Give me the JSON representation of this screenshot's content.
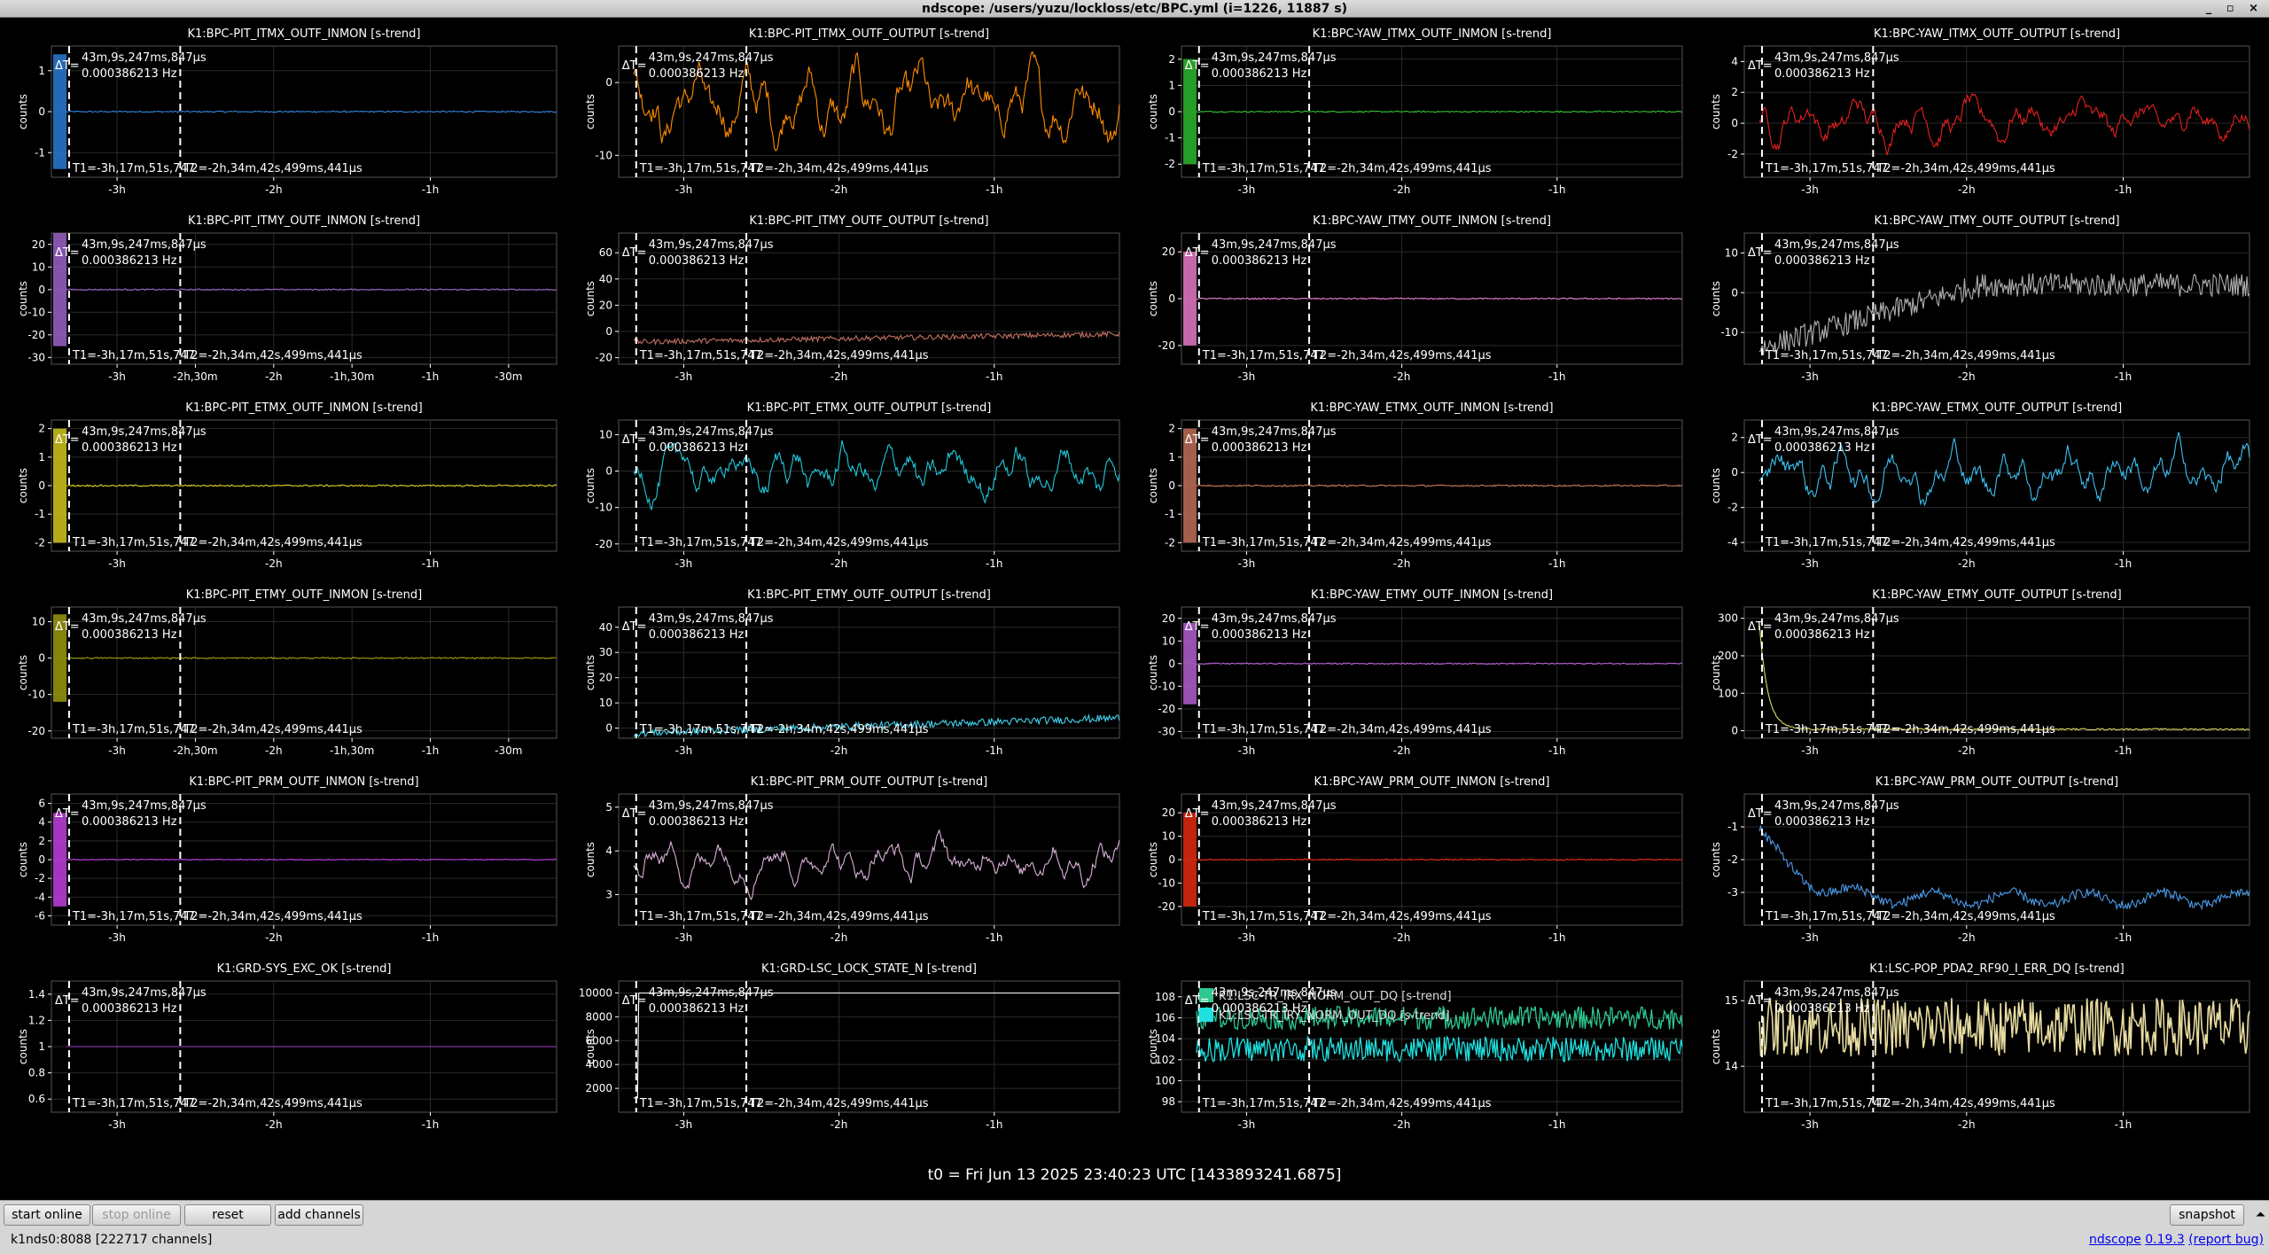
{
  "window": {
    "title": "ndscope: /users/yuzu/lockloss/etc/BPC.yml (i=1226, 11887 s)",
    "controls": "_ ▫ ×"
  },
  "cursor": {
    "dt_label": "ΔT=",
    "dt": "43m,9s,247ms,847μs",
    "freq": "0.000386213 Hz",
    "t1": "T1=-3h,17m,51s,747",
    "t2": "T2=-2h,34m,42s,499ms,441μs"
  },
  "colors": {
    "background": "#000000",
    "grid": "#303030",
    "axis": "#ffffff",
    "cursor": "#ffffff"
  },
  "plots": [
    {
      "title": "K1:BPC-PIT_ITMX_OUTF_INMON [s-trend]",
      "ylabel": "counts",
      "yticks": [
        "1",
        "0",
        "-1"
      ],
      "ylim": [
        -1.6,
        1.6
      ],
      "xticks": [
        "-3h",
        "-2h",
        "-1h"
      ],
      "color": "#2b7bd3",
      "pattern": "flat",
      "base": 0,
      "amp": 0.02,
      "burst": 1.4
    },
    {
      "title": "K1:BPC-PIT_ITMX_OUTF_OUTPUT [s-trend]",
      "ylabel": "counts",
      "yticks": [
        "0",
        "-10"
      ],
      "ylim": [
        -13,
        5
      ],
      "xticks": [
        "-3h",
        "-2h",
        "-1h"
      ],
      "color": "#ff8c00",
      "pattern": "wave",
      "base": -3,
      "amp": 5,
      "burst": 0
    },
    {
      "title": "K1:BPC-YAW_ITMX_OUTF_INMON [s-trend]",
      "ylabel": "counts",
      "yticks": [
        "2",
        "1",
        "0",
        "-1",
        "-2"
      ],
      "ylim": [
        -2.5,
        2.5
      ],
      "xticks": [
        "-3h",
        "-2h",
        "-1h"
      ],
      "color": "#2db82d",
      "pattern": "flat",
      "base": 0,
      "amp": 0.03,
      "burst": 2
    },
    {
      "title": "K1:BPC-YAW_ITMX_OUTF_OUTPUT [s-trend]",
      "ylabel": "counts",
      "yticks": [
        "4",
        "2",
        "0",
        "-2"
      ],
      "ylim": [
        -3.5,
        5
      ],
      "xticks": [
        "-3h",
        "-2h",
        "-1h"
      ],
      "color": "#e62020",
      "pattern": "wave",
      "base": 0.2,
      "amp": 1.4,
      "burst": 0
    },
    {
      "title": "K1:BPC-PIT_ITMY_OUTF_INMON [s-trend]",
      "ylabel": "counts",
      "yticks": [
        "20",
        "10",
        "0",
        "-10",
        "-20",
        "-30"
      ],
      "ylim": [
        -33,
        25
      ],
      "xticks": [
        "-3h",
        "-2h,30m",
        "-2h",
        "-1h,30m",
        "-1h",
        "-30m"
      ],
      "color": "#9b63c9",
      "pattern": "flat",
      "base": 0,
      "amp": 0.3,
      "burst": 25
    },
    {
      "title": "K1:BPC-PIT_ITMY_OUTF_OUTPUT [s-trend]",
      "ylabel": "counts",
      "yticks": [
        "60",
        "40",
        "20",
        "0",
        "-20"
      ],
      "ylim": [
        -25,
        75
      ],
      "xticks": [
        "-3h",
        "-2h",
        "-1h"
      ],
      "color": "#c07060",
      "pattern": "drift",
      "base": -8,
      "amp": 2,
      "burst": 0
    },
    {
      "title": "K1:BPC-YAW_ITMY_OUTF_INMON [s-trend]",
      "ylabel": "counts",
      "yticks": [
        "20",
        "0",
        "-20"
      ],
      "ylim": [
        -28,
        28
      ],
      "xticks": [
        "-3h",
        "-2h",
        "-1h"
      ],
      "color": "#e879c8",
      "pattern": "flat",
      "base": 0,
      "amp": 0.3,
      "burst": 20
    },
    {
      "title": "K1:BPC-YAW_ITMY_OUTF_OUTPUT [s-trend]",
      "ylabel": "counts",
      "yticks": [
        "10",
        "0",
        "-10"
      ],
      "ylim": [
        -18,
        15
      ],
      "xticks": [
        "-3h",
        "-2h",
        "-1h"
      ],
      "color": "#b0b0b0",
      "pattern": "rise",
      "base": 0,
      "amp": 3,
      "burst": 0
    },
    {
      "title": "K1:BPC-PIT_ETMX_OUTF_INMON [s-trend]",
      "ylabel": "counts",
      "yticks": [
        "2",
        "1",
        "0",
        "-1",
        "-2"
      ],
      "ylim": [
        -2.3,
        2.3
      ],
      "xticks": [
        "-3h",
        "-2h",
        "-1h"
      ],
      "color": "#d4c81c",
      "pattern": "flat",
      "base": 0,
      "amp": 0.03,
      "burst": 2
    },
    {
      "title": "K1:BPC-PIT_ETMX_OUTF_OUTPUT [s-trend]",
      "ylabel": "counts",
      "yticks": [
        "10",
        "0",
        "-10",
        "-20"
      ],
      "ylim": [
        -22,
        14
      ],
      "xticks": [
        "-3h",
        "-2h",
        "-1h"
      ],
      "color": "#22c8dc",
      "pattern": "wave",
      "base": 0,
      "amp": 7,
      "burst": 0
    },
    {
      "title": "K1:BPC-YAW_ETMX_OUTF_INMON [s-trend]",
      "ylabel": "counts",
      "yticks": [
        "2",
        "1",
        "0",
        "-1",
        "-2"
      ],
      "ylim": [
        -2.3,
        2.3
      ],
      "xticks": [
        "-3h",
        "-2h",
        "-1h"
      ],
      "color": "#c07058",
      "pattern": "flat",
      "base": 0,
      "amp": 0.03,
      "burst": 2
    },
    {
      "title": "K1:BPC-YAW_ETMX_OUTF_OUTPUT [s-trend]",
      "ylabel": "counts",
      "yticks": [
        "2",
        "0",
        "-2",
        "-4"
      ],
      "ylim": [
        -4.5,
        3
      ],
      "xticks": [
        "-3h",
        "-2h",
        "-1h"
      ],
      "color": "#3cc0f0",
      "pattern": "wave",
      "base": 0,
      "amp": 1.5,
      "burst": 0
    },
    {
      "title": "K1:BPC-PIT_ETMY_OUTF_INMON [s-trend]",
      "ylabel": "counts",
      "yticks": [
        "10",
        "0",
        "-10",
        "-20"
      ],
      "ylim": [
        -22,
        14
      ],
      "xticks": [
        "-3h",
        "-2h,30m",
        "-2h",
        "-1h,30m",
        "-1h",
        "-30m"
      ],
      "color": "#9a9a10",
      "pattern": "flat",
      "base": 0,
      "amp": 0.2,
      "burst": 12
    },
    {
      "title": "K1:BPC-PIT_ETMY_OUTF_OUTPUT [s-trend]",
      "ylabel": "counts",
      "yticks": [
        "40",
        "30",
        "20",
        "10",
        "0"
      ],
      "ylim": [
        -4,
        48
      ],
      "xticks": [
        "-3h",
        "-2h",
        "-1h"
      ],
      "color": "#40d0ea",
      "pattern": "drift",
      "base": -2,
      "amp": 1.5,
      "burst": 0
    },
    {
      "title": "K1:BPC-YAW_ETMY_OUTF_INMON [s-trend]",
      "ylabel": "counts",
      "yticks": [
        "20",
        "10",
        "0",
        "-10",
        "-20",
        "-30"
      ],
      "ylim": [
        -33,
        25
      ],
      "xticks": [
        "-3h",
        "-2h",
        "-1h"
      ],
      "color": "#b35fd0",
      "pattern": "flat",
      "base": 0,
      "amp": 0.3,
      "burst": 18
    },
    {
      "title": "K1:BPC-YAW_ETMY_OUTF_OUTPUT [s-trend]",
      "ylabel": "counts",
      "yticks": [
        "300",
        "200",
        "100",
        "0"
      ],
      "ylim": [
        -20,
        330
      ],
      "xticks": [
        "-3h",
        "-2h",
        "-1h"
      ],
      "color": "#dcdc60",
      "pattern": "decay",
      "base": 0,
      "amp": 2,
      "burst": 0
    },
    {
      "title": "K1:BPC-PIT_PRM_OUTF_INMON [s-trend]",
      "ylabel": "counts",
      "yticks": [
        "6",
        "4",
        "2",
        "0",
        "-2",
        "-4",
        "-6"
      ],
      "ylim": [
        -7,
        7
      ],
      "xticks": [
        "-3h",
        "-2h",
        "-1h"
      ],
      "color": "#c040e0",
      "pattern": "flat",
      "base": 0,
      "amp": 0.05,
      "burst": 5
    },
    {
      "title": "K1:BPC-PIT_PRM_OUTF_OUTPUT [s-trend]",
      "ylabel": "counts",
      "yticks": [
        "5",
        "4",
        "3"
      ],
      "ylim": [
        2.3,
        5.3
      ],
      "xticks": [
        "-3h",
        "-2h",
        "-1h"
      ],
      "color": "#d8b0d8",
      "pattern": "wave",
      "base": 3.8,
      "amp": 0.5,
      "burst": 0
    },
    {
      "title": "K1:BPC-YAW_PRM_OUTF_INMON [s-trend]",
      "ylabel": "counts",
      "yticks": [
        "20",
        "10",
        "0",
        "-10",
        "-20"
      ],
      "ylim": [
        -28,
        28
      ],
      "xticks": [
        "-3h",
        "-2h",
        "-1h"
      ],
      "color": "#e62a10",
      "pattern": "flat",
      "base": 0,
      "amp": 0.3,
      "burst": 20
    },
    {
      "title": "K1:BPC-YAW_PRM_OUTF_OUTPUT [s-trend]",
      "ylabel": "counts",
      "yticks": [
        "-1",
        "-2",
        "-3"
      ],
      "ylim": [
        -4,
        0
      ],
      "xticks": [
        "-3h",
        "-2h",
        "-1h"
      ],
      "color": "#4a9ae8",
      "pattern": "decayneg",
      "base": -3.2,
      "amp": 0.15,
      "burst": 0
    },
    {
      "title": "K1:GRD-SYS_EXC_OK [s-trend]",
      "ylabel": "counts",
      "yticks": [
        "1.4",
        "1.2",
        "1",
        "0.8",
        "0.6"
      ],
      "ylim": [
        0.5,
        1.5
      ],
      "xticks": [
        "-3h",
        "-2h",
        "-1h"
      ],
      "color": "#9b40c9",
      "pattern": "flat",
      "base": 1,
      "amp": 0,
      "burst": 0
    },
    {
      "title": "K1:GRD-LSC_LOCK_STATE_N [s-trend]",
      "ylabel": "counts",
      "yticks": [
        "10000",
        "8000",
        "6000",
        "4000",
        "2000"
      ],
      "ylim": [
        0,
        11000
      ],
      "xticks": [
        "-3h",
        "-2h",
        "-1h"
      ],
      "color": "#ffffff",
      "pattern": "step",
      "base": 10000,
      "amp": 0,
      "burst": 0
    },
    {
      "title": "",
      "ylabel": "counts",
      "yticks": [
        "108",
        "106",
        "104",
        "102",
        "100",
        "98"
      ],
      "ylim": [
        97,
        109.5
      ],
      "xticks": [
        "-3h",
        "-2h",
        "-1h"
      ],
      "color": "#2ec890",
      "pattern": "twin",
      "base": 106,
      "amp": 0.8,
      "burst": 0,
      "legend": [
        {
          "name": "K1:LSC-TR_IRX_NORM_OUT_DQ [s-trend]",
          "color": "#2ec890"
        },
        {
          "name": "K1:LSC-TR_IRY_NORM_OUT_DQ [s-trend]",
          "color": "#20e0e0"
        }
      ]
    },
    {
      "title": "K1:LSC-POP_PDA2_RF90_I_ERR_DQ [s-trend]",
      "ylabel": "counts",
      "yticks": [
        "15",
        "14"
      ],
      "ylim": [
        13.3,
        15.3
      ],
      "xticks": [
        "-3h",
        "-2h",
        "-1h"
      ],
      "color": "#e8dca0",
      "pattern": "band",
      "base": 14.6,
      "amp": 0.4,
      "burst": 0
    }
  ],
  "t0_label": "t0 = Fri Jun 13 2025 23:40:23 UTC [1433893241.6875]",
  "buttons": {
    "start_online": "start online",
    "stop_online": "stop online",
    "reset": "reset",
    "add_channels": "add channels",
    "snapshot": "snapshot"
  },
  "status": {
    "server": "k1nds0:8088  [222717 channels]",
    "app": "ndscope",
    "version": "0.19.3",
    "report": "(report bug)"
  }
}
